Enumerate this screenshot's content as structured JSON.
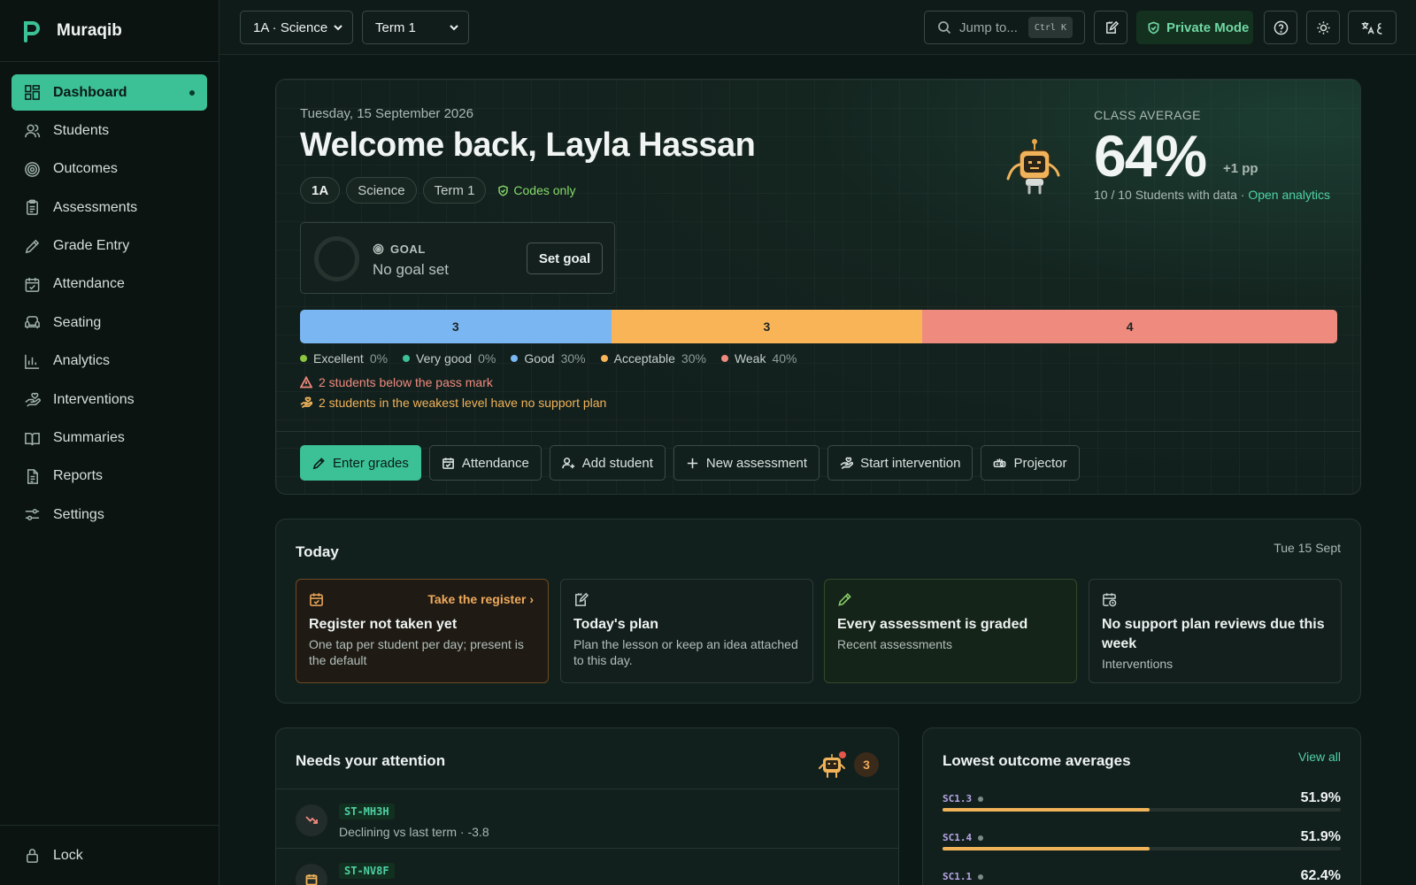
{
  "app": {
    "name": "Muraqib"
  },
  "sidebar": {
    "items": [
      {
        "label": "Dashboard",
        "icon": "grid-icon",
        "active": true
      },
      {
        "label": "Students",
        "icon": "users-icon"
      },
      {
        "label": "Outcomes",
        "icon": "target-icon"
      },
      {
        "label": "Assessments",
        "icon": "clipboard-icon"
      },
      {
        "label": "Grade Entry",
        "icon": "pen-icon"
      },
      {
        "label": "Attendance",
        "icon": "calendar-check-icon"
      },
      {
        "label": "Seating",
        "icon": "armchair-icon"
      },
      {
        "label": "Analytics",
        "icon": "bar-chart-icon"
      },
      {
        "label": "Interventions",
        "icon": "hand-heart-icon"
      },
      {
        "label": "Summaries",
        "icon": "book-open-icon"
      },
      {
        "label": "Reports",
        "icon": "file-text-icon"
      },
      {
        "label": "Settings",
        "icon": "sliders-icon"
      }
    ],
    "lock_label": "Lock"
  },
  "topbar": {
    "class_select": "1A · Science",
    "term_select": "Term 1",
    "search_placeholder": "Jump to...",
    "search_kbd": "Ctrl K",
    "private_mode": "Private Mode"
  },
  "hero": {
    "date": "Tuesday, 15 September 2026",
    "welcome": "Welcome back, Layla Hassan",
    "chips": {
      "class": "1A",
      "subject": "Science",
      "term": "Term 1",
      "codes": "Codes only"
    },
    "goal": {
      "label": "GOAL",
      "text": "No goal set",
      "button": "Set goal"
    },
    "average": {
      "label": "CLASS AVERAGE",
      "value": "64%",
      "delta": "+1 pp",
      "sub": "10 / 10 Students with data · ",
      "link": "Open analytics"
    },
    "distribution": [
      {
        "label": "Excellent",
        "count": 0,
        "pct": "0%",
        "color": "#8cc63f"
      },
      {
        "label": "Very good",
        "count": 0,
        "pct": "0%",
        "color": "#3cc196"
      },
      {
        "label": "Good",
        "count": 3,
        "pct": "30%",
        "color": "#7ab6f2"
      },
      {
        "label": "Acceptable",
        "count": 3,
        "pct": "30%",
        "color": "#f9b458"
      },
      {
        "label": "Weak",
        "count": 4,
        "pct": "40%",
        "color": "#ef8a7e"
      }
    ],
    "alerts": {
      "below_pass": "2 students below the pass mark",
      "no_plan": "2 students in the weakest level have no support plan"
    },
    "actions": {
      "enter_grades": "Enter grades",
      "attendance": "Attendance",
      "add_student": "Add student",
      "new_assessment": "New assessment",
      "start_intervention": "Start intervention",
      "projector": "Projector"
    }
  },
  "today": {
    "title": "Today",
    "date": "Tue 15 Sept",
    "cards": [
      {
        "title": "Register not taken yet",
        "desc": "One tap per student per day; present is the default",
        "link": "Take the register"
      },
      {
        "title": "Today's plan",
        "desc": "Plan the lesson or keep an idea attached to this day."
      },
      {
        "title": "Every assessment is graded",
        "desc": "Recent assessments"
      },
      {
        "title": "No support plan reviews due this week",
        "desc": "Interventions"
      }
    ]
  },
  "attention": {
    "title": "Needs your attention",
    "count": "3",
    "rows": [
      {
        "code": "ST-MH3H",
        "desc": "Declining vs last term · -3.8"
      },
      {
        "code": "ST-NV8F",
        "desc": ""
      }
    ]
  },
  "outcomes": {
    "title": "Lowest outcome averages",
    "view_all": "View all",
    "rows": [
      {
        "code": "SC1.3",
        "value": "51.9%",
        "fraction": 0.519
      },
      {
        "code": "SC1.4",
        "value": "51.9%",
        "fraction": 0.519
      },
      {
        "code": "SC1.1",
        "value": "62.4%",
        "fraction": 0.624
      }
    ]
  }
}
